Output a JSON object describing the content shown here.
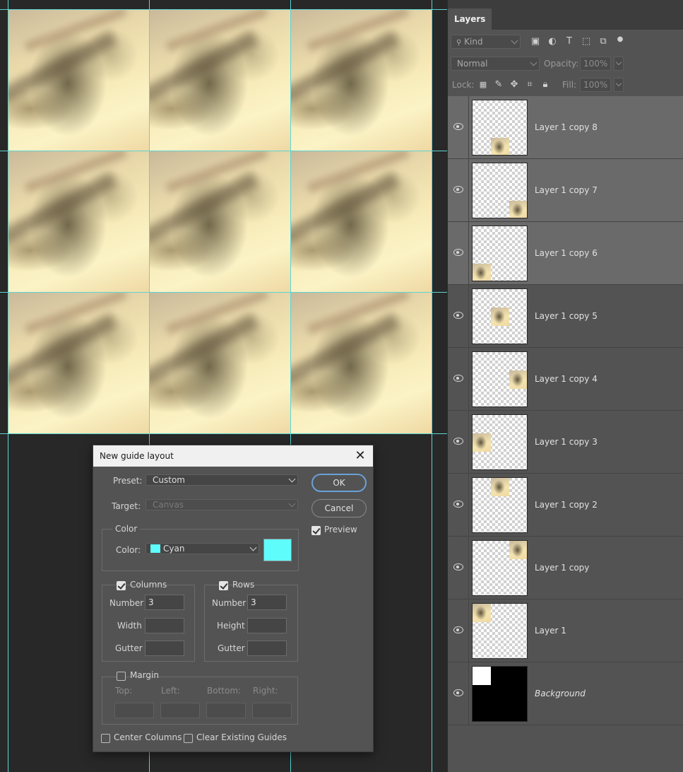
{
  "dialog": {
    "title": "New guide layout",
    "preset_label": "Preset:",
    "preset_value": "Custom",
    "target_label": "Target:",
    "target_value": "Canvas",
    "ok_label": "OK",
    "cancel_label": "Cancel",
    "preview_label": "Preview",
    "preview_checked": true,
    "color_group_title": "Color",
    "color_label": "Color:",
    "color_value": "Cyan",
    "color_hex": "#5ffcfc",
    "columns_title": "Columns",
    "columns_checked": true,
    "columns_number_label": "Number",
    "columns_number_value": "3",
    "width_label": "Width",
    "columns_gutter_label": "Gutter",
    "rows_title": "Rows",
    "rows_checked": true,
    "rows_number_label": "Number",
    "rows_number_value": "3",
    "height_label": "Height",
    "rows_gutter_label": "Gutter",
    "margin_title": "Margin",
    "margin_checked": false,
    "top_label": "Top:",
    "left_label": "Left:",
    "bottom_label": "Bottom:",
    "right_label": "Right:",
    "center_columns_label": "Center Columns",
    "clear_guides_label": "Clear Existing Guides"
  },
  "panel": {
    "tab_label": "Layers",
    "kind_placeholder": "Kind",
    "blend_mode": "Normal",
    "opacity_label": "Opacity:",
    "opacity_value": "100%",
    "lock_label": "Lock:",
    "fill_label": "Fill:",
    "fill_value": "100%",
    "layers": [
      {
        "name": "Layer 1 copy 8",
        "selected": true,
        "thumb": "bottom-center"
      },
      {
        "name": "Layer 1 copy 7",
        "selected": true,
        "thumb": "bottom-right"
      },
      {
        "name": "Layer 1 copy 6",
        "selected": true,
        "thumb": "bottom-left"
      },
      {
        "name": "Layer 1 copy 5",
        "selected": false,
        "thumb": "middle-center"
      },
      {
        "name": "Layer 1 copy 4",
        "selected": false,
        "thumb": "middle-right"
      },
      {
        "name": "Layer 1 copy 3",
        "selected": false,
        "thumb": "middle-left"
      },
      {
        "name": "Layer 1 copy 2",
        "selected": false,
        "thumb": "top-center"
      },
      {
        "name": "Layer 1 copy",
        "selected": false,
        "thumb": "top-right"
      },
      {
        "name": "Layer 1",
        "selected": false,
        "thumb": "top-left"
      },
      {
        "name": "Background",
        "selected": false,
        "thumb": "background"
      }
    ]
  },
  "canvas": {
    "guide_color": "#5fd4d4"
  }
}
